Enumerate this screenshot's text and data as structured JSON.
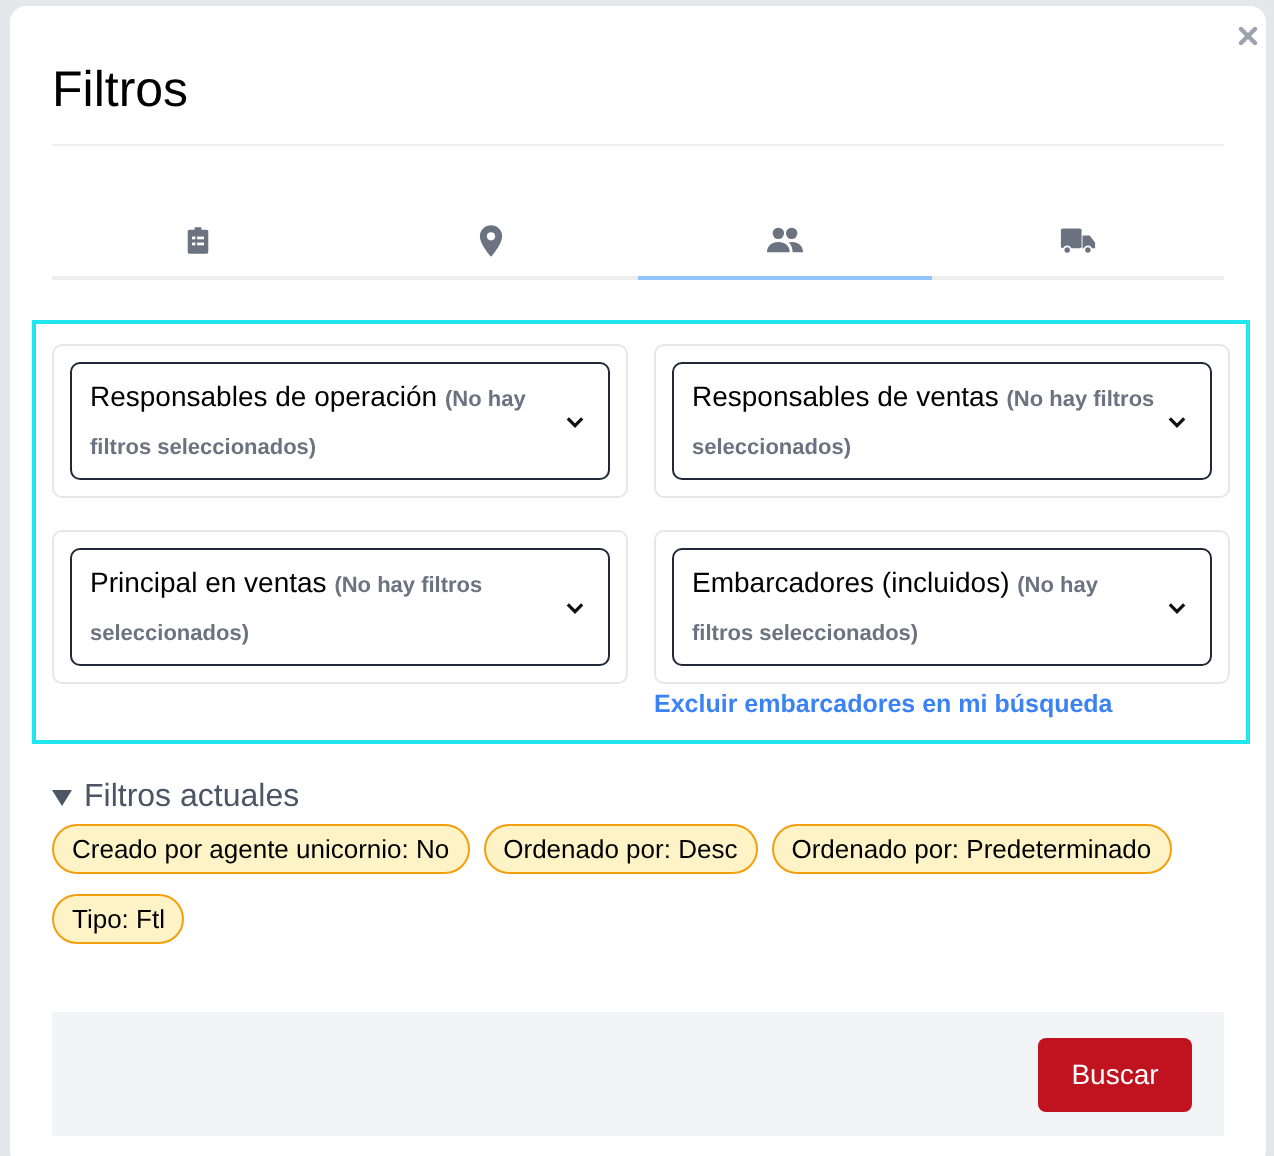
{
  "dialog": {
    "title": "Filtros"
  },
  "tabs": [
    {
      "kind": "clipboard",
      "selected": false
    },
    {
      "kind": "pin",
      "selected": false
    },
    {
      "kind": "people",
      "selected": true
    },
    {
      "kind": "truck",
      "selected": false
    }
  ],
  "dropdowns": [
    {
      "label": "Responsables de operación",
      "hint": "(No hay filtros seleccionados)"
    },
    {
      "label": "Responsables de ventas",
      "hint": "(No hay filtros seleccionados)"
    },
    {
      "label": "Principal en ventas",
      "hint": "(No hay filtros seleccionados)"
    },
    {
      "label": "Embarcadores (incluidos)",
      "hint": "(No hay filtros seleccionados)",
      "link": "Excluir embarcadores en mi búsqueda"
    }
  ],
  "current_filters": {
    "title": "Filtros actuales",
    "expanded": true,
    "chips": [
      "Creado por agente unicornio: No",
      "Ordenado por: Desc",
      "Ordenado por: Predeterminado",
      "Tipo: Ftl"
    ]
  },
  "footer": {
    "button": "Buscar"
  }
}
